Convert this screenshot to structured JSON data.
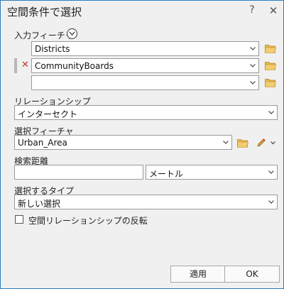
{
  "window": {
    "title": "空間条件で選択",
    "help_glyph": "?",
    "close_glyph": "✕"
  },
  "input_features": {
    "label": "入力フィーチャ",
    "rows": [
      {
        "value": "Districts"
      },
      {
        "value": "CommunityBoards",
        "remove_glyph": "✕"
      },
      {
        "value": ""
      }
    ]
  },
  "relationship": {
    "label": "リレーションシップ",
    "value": "インターセクト"
  },
  "selecting_features": {
    "label": "選択フィーチャ",
    "value": "Urban_Area"
  },
  "search_distance": {
    "label": "検索距離",
    "value": "",
    "unit": "メートル"
  },
  "selection_type": {
    "label": "選択するタイプ",
    "value": "新しい選択"
  },
  "invert": {
    "label": "空間リレーションシップの反転",
    "checked": false
  },
  "buttons": {
    "apply": "適用",
    "ok": "OK"
  },
  "colors": {
    "folder": "#e8b64c",
    "pencil": "#e0a43a",
    "accent_border": "#2e7fbf"
  }
}
